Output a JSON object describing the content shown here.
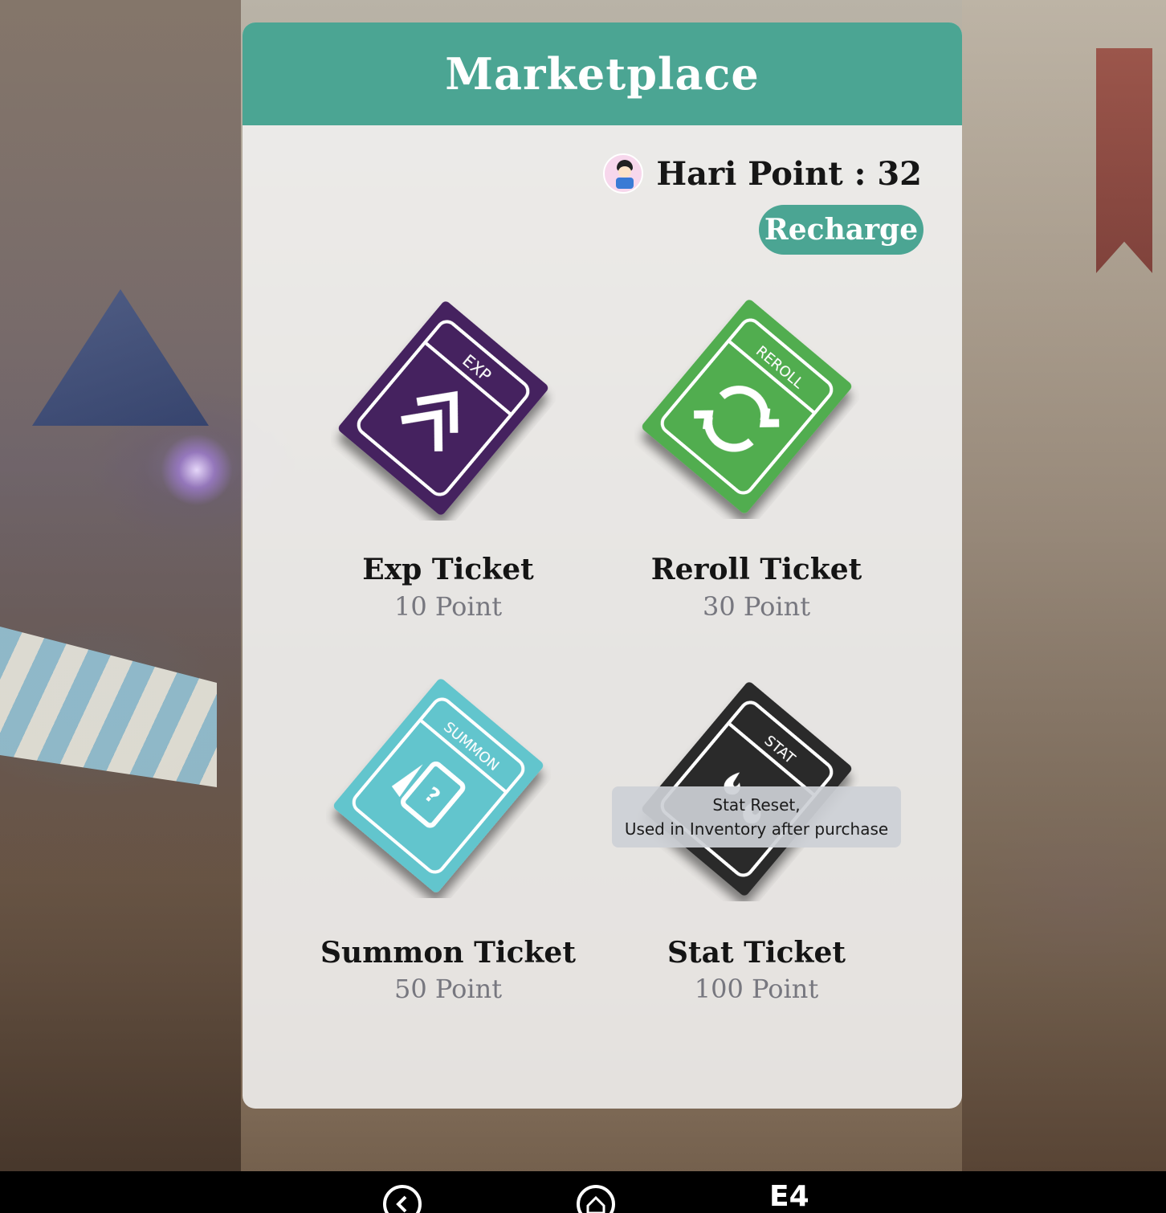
{
  "header": {
    "title": "Marketplace"
  },
  "user": {
    "points_label": "Hari Point : 32",
    "recharge_label": "Recharge"
  },
  "items": [
    {
      "name": "Exp Ticket",
      "price": "10 Point",
      "tag": "EXP",
      "color": "#45205f",
      "icon": "double-chevron-icon"
    },
    {
      "name": "Reroll Ticket",
      "price": "30 Point",
      "tag": "REROLL",
      "color": "#51ad4f",
      "icon": "refresh-icon"
    },
    {
      "name": "Summon Ticket",
      "price": "50 Point",
      "tag": "SUMMON",
      "color": "#62c5cd",
      "icon": "mystery-card-icon"
    },
    {
      "name": "Stat Ticket",
      "price": "100 Point",
      "tag": "STAT",
      "color": "#2a2a2a",
      "icon": "flames-icon"
    }
  ],
  "tooltip": {
    "line1": "Stat Reset,",
    "line2": "Used in Inventory after purchase"
  },
  "navbar": {
    "back_icon": "back-icon",
    "home_icon": "home-icon",
    "brand_text": "E4"
  }
}
